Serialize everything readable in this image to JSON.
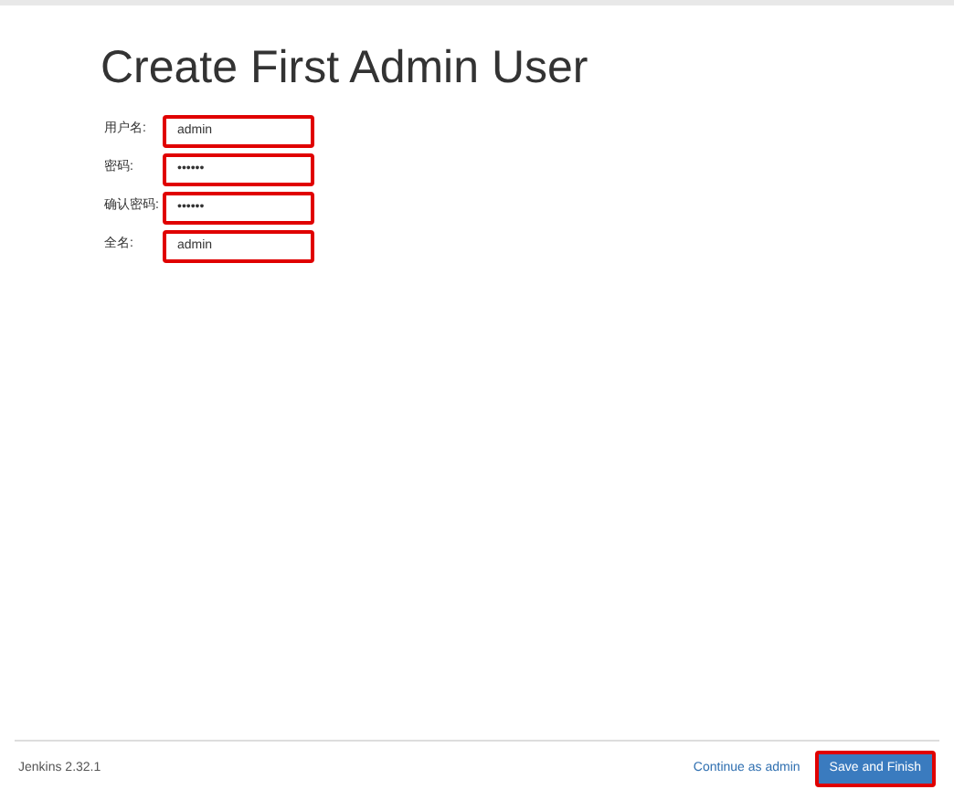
{
  "title": "Create First Admin User",
  "fields": [
    {
      "label": "用户名:",
      "value": "admin",
      "highlighted": true
    },
    {
      "label": "密码:",
      "value": "••••••",
      "highlighted": true
    },
    {
      "label": "确认密码:",
      "value": "••••••",
      "highlighted": true
    },
    {
      "label": "全名:",
      "value": "admin",
      "highlighted": true
    }
  ],
  "footer": {
    "version": "Jenkins 2.32.1",
    "continue_link": "Continue as admin",
    "save_button": {
      "label": "Save and Finish",
      "highlighted": true
    }
  }
}
